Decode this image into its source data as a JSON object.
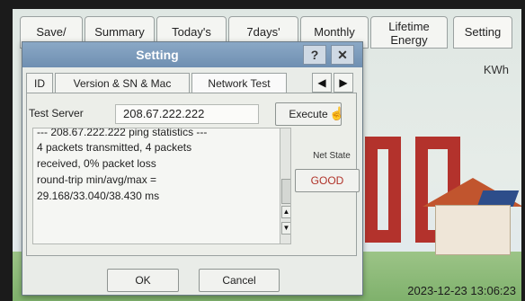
{
  "top_tabs": [
    {
      "label": "Save/"
    },
    {
      "label": "Summary"
    },
    {
      "label": "Today's"
    },
    {
      "label": "7days'"
    },
    {
      "label": "Monthly"
    },
    {
      "label_line1": "Lifetime",
      "label_line2": "Energy"
    },
    {
      "label": "Setting"
    }
  ],
  "unit": "KWh",
  "timestamp": "2023-12-23 13:06:23",
  "dialog": {
    "title": "Setting",
    "help_label": "?",
    "close_label": "✕",
    "tabs": [
      "ID",
      "Version & SN & Mac",
      "Network Test"
    ],
    "active_tab": "Network Test",
    "prev_arrow": "◀",
    "next_arrow": "▶",
    "network_test": {
      "server_label": "Test Server",
      "server_value": "208.67.222.222",
      "execute_label": "Execute",
      "output_lines": [
        "--- 208.67.222.222 ping statistics ---",
        "4 packets transmitted, 4 packets",
        "received, 0% packet loss",
        "round-trip min/avg/max =",
        "29.168/33.040/38.430 ms"
      ],
      "net_state_label": "Net State",
      "net_state_value": "GOOD"
    },
    "ok_label": "OK",
    "cancel_label": "Cancel"
  },
  "colors": {
    "titlebar": "#7b9bbc",
    "digit_red": "#b3322c",
    "net_state_good": "#b0332a"
  }
}
